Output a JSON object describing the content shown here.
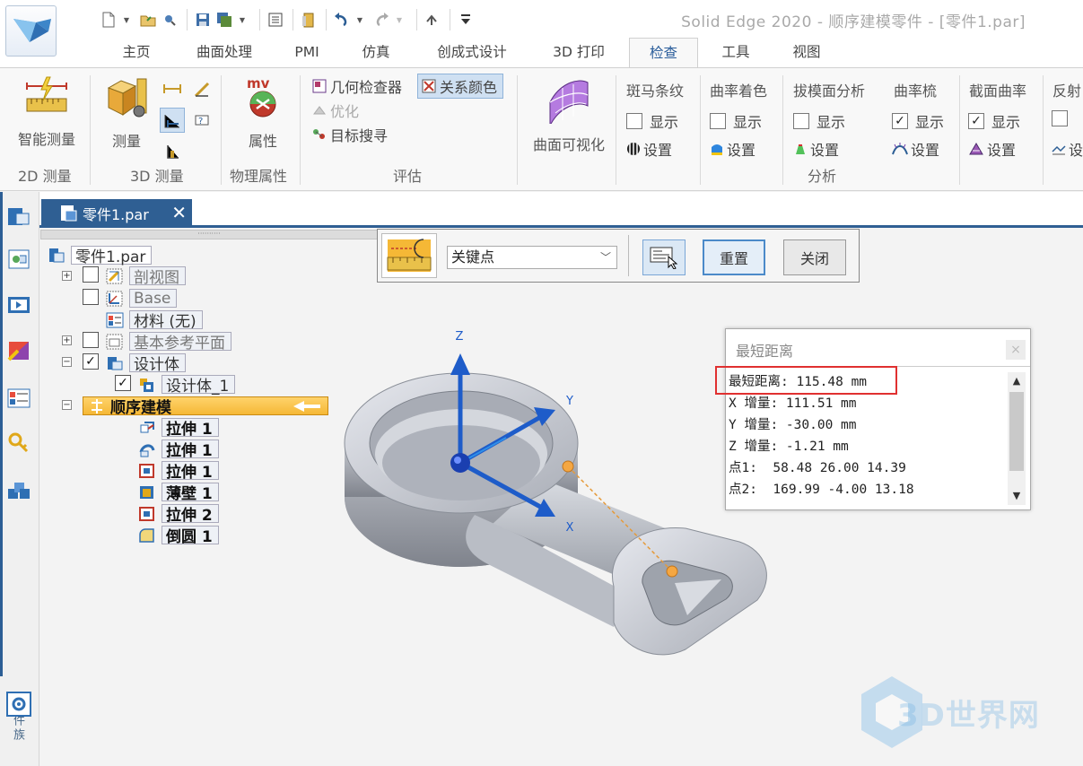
{
  "window": {
    "title": "Solid Edge 2020 - 顺序建模零件 - [零件1.par]"
  },
  "ribbon_tabs": [
    {
      "label": "主页"
    },
    {
      "label": "曲面处理"
    },
    {
      "label": "PMI"
    },
    {
      "label": "仿真"
    },
    {
      "label": "创成式设计"
    },
    {
      "label": "3D 打印"
    },
    {
      "label": "检查",
      "active": true
    },
    {
      "label": "工具"
    },
    {
      "label": "视图"
    }
  ],
  "ribbon": {
    "groups": {
      "measure_2d": "2D 测量",
      "measure_3d": "3D 测量",
      "physical": "物理属性",
      "evaluate": "评估",
      "analysis": "分析"
    },
    "smart_measure": "智能测量",
    "measure": "测量",
    "properties": "属性",
    "geometry_inspector": "几何检查器",
    "relation_colors": "关系颜色",
    "optimize": "优化",
    "target_search": "目标搜寻",
    "surface_visualization": "曲面可视化",
    "analysis_columns": [
      {
        "title": "斑马条纹",
        "show": "显示",
        "checked": false,
        "settings": "设置"
      },
      {
        "title": "曲率着色",
        "show": "显示",
        "checked": false,
        "settings": "设置"
      },
      {
        "title": "拔模面分析",
        "show": "显示",
        "checked": false,
        "settings": "设置"
      },
      {
        "title": "曲率梳",
        "show": "显示",
        "checked": true,
        "settings": "设置"
      },
      {
        "title": "截面曲率",
        "show": "显示",
        "checked": true,
        "settings": "设置"
      },
      {
        "title": "反射",
        "show": "",
        "checked": false,
        "settings": "设"
      }
    ]
  },
  "document_tab": {
    "label": "零件1.par",
    "close": "✕"
  },
  "left_toolbar": {
    "family_label": "零件族"
  },
  "tree": {
    "root": "零件1.par",
    "nodes": [
      {
        "label": "剖视图",
        "faded": true
      },
      {
        "label": "Base",
        "faded": true
      },
      {
        "label": "材料 (无)"
      },
      {
        "label": "基本参考平面",
        "faded": true
      },
      {
        "label": "设计体"
      },
      {
        "label": "设计体_1"
      },
      {
        "label": "顺序建模"
      },
      {
        "label": "拉伸 1"
      },
      {
        "label": "拉伸 1"
      },
      {
        "label": "拉伸 1"
      },
      {
        "label": "薄壁 1"
      },
      {
        "label": "拉伸 2"
      },
      {
        "label": "倒圆 1"
      }
    ]
  },
  "command_bar": {
    "selected_option": "关键点",
    "reset": "重置",
    "close": "关闭"
  },
  "triad": {
    "z": "Z",
    "y": "Y",
    "x": "X"
  },
  "distance_dialog": {
    "title": "最短距离",
    "close": "×",
    "lines": [
      "最短距离: 115.48 mm",
      "X 增量: 111.51 mm",
      "Y 增量: -30.00 mm",
      "Z 增量: -1.21 mm",
      "点1:  58.48 26.00 14.39",
      "点2:  169.99 -4.00 13.18"
    ]
  },
  "watermark": "3D世界网",
  "colors": {
    "accent": "#2f5f93",
    "highlight": "#e03030",
    "tree_active": "#f5b836"
  }
}
